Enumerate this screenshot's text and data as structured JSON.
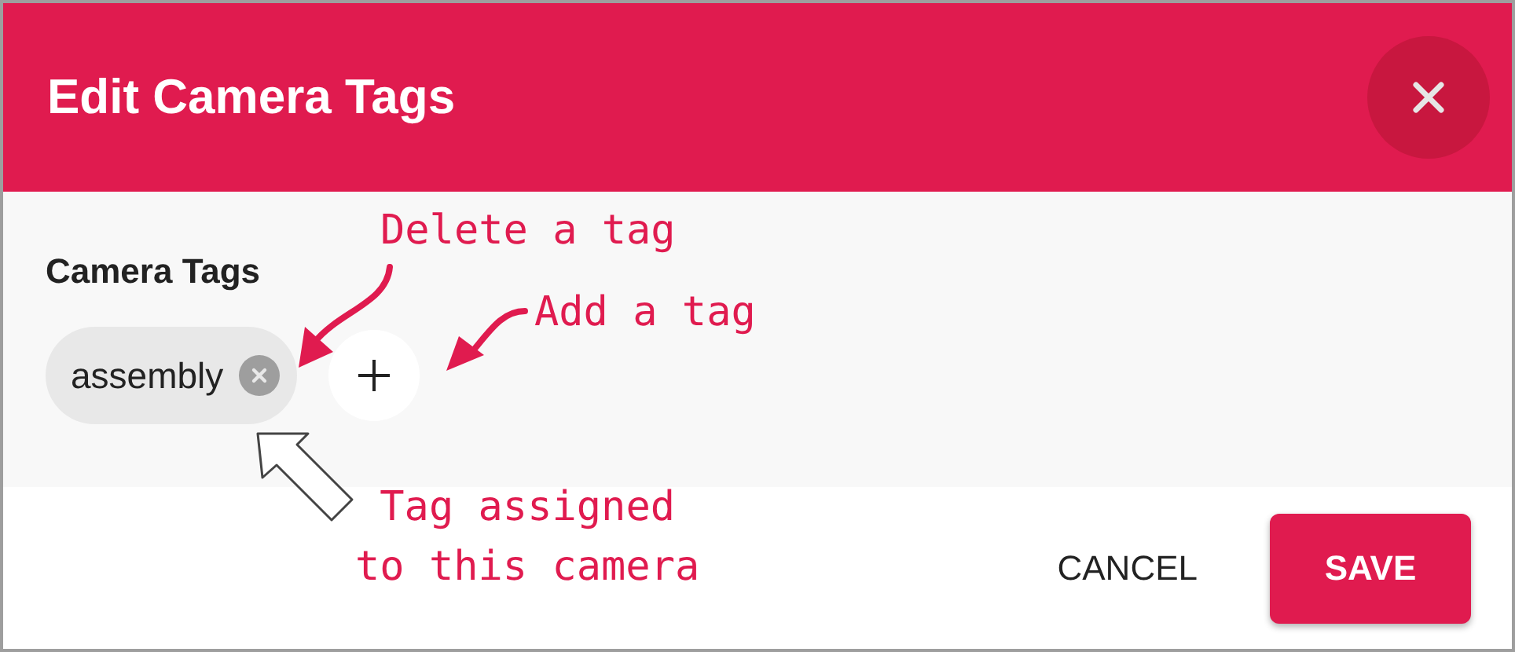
{
  "dialog": {
    "title": "Edit Camera Tags"
  },
  "section": {
    "label": "Camera Tags"
  },
  "tags": [
    {
      "label": "assembly"
    }
  ],
  "buttons": [
    {
      "label": "CANCEL",
      "kind": "text"
    },
    {
      "label": "SAVE",
      "kind": "primary"
    }
  ],
  "annotations": [
    {
      "text": "Delete a tag",
      "kind": "delete"
    },
    {
      "text": "Add a tag",
      "kind": "add"
    },
    {
      "text": "Tag assigned\nto this camera",
      "kind": "assigned"
    }
  ]
}
